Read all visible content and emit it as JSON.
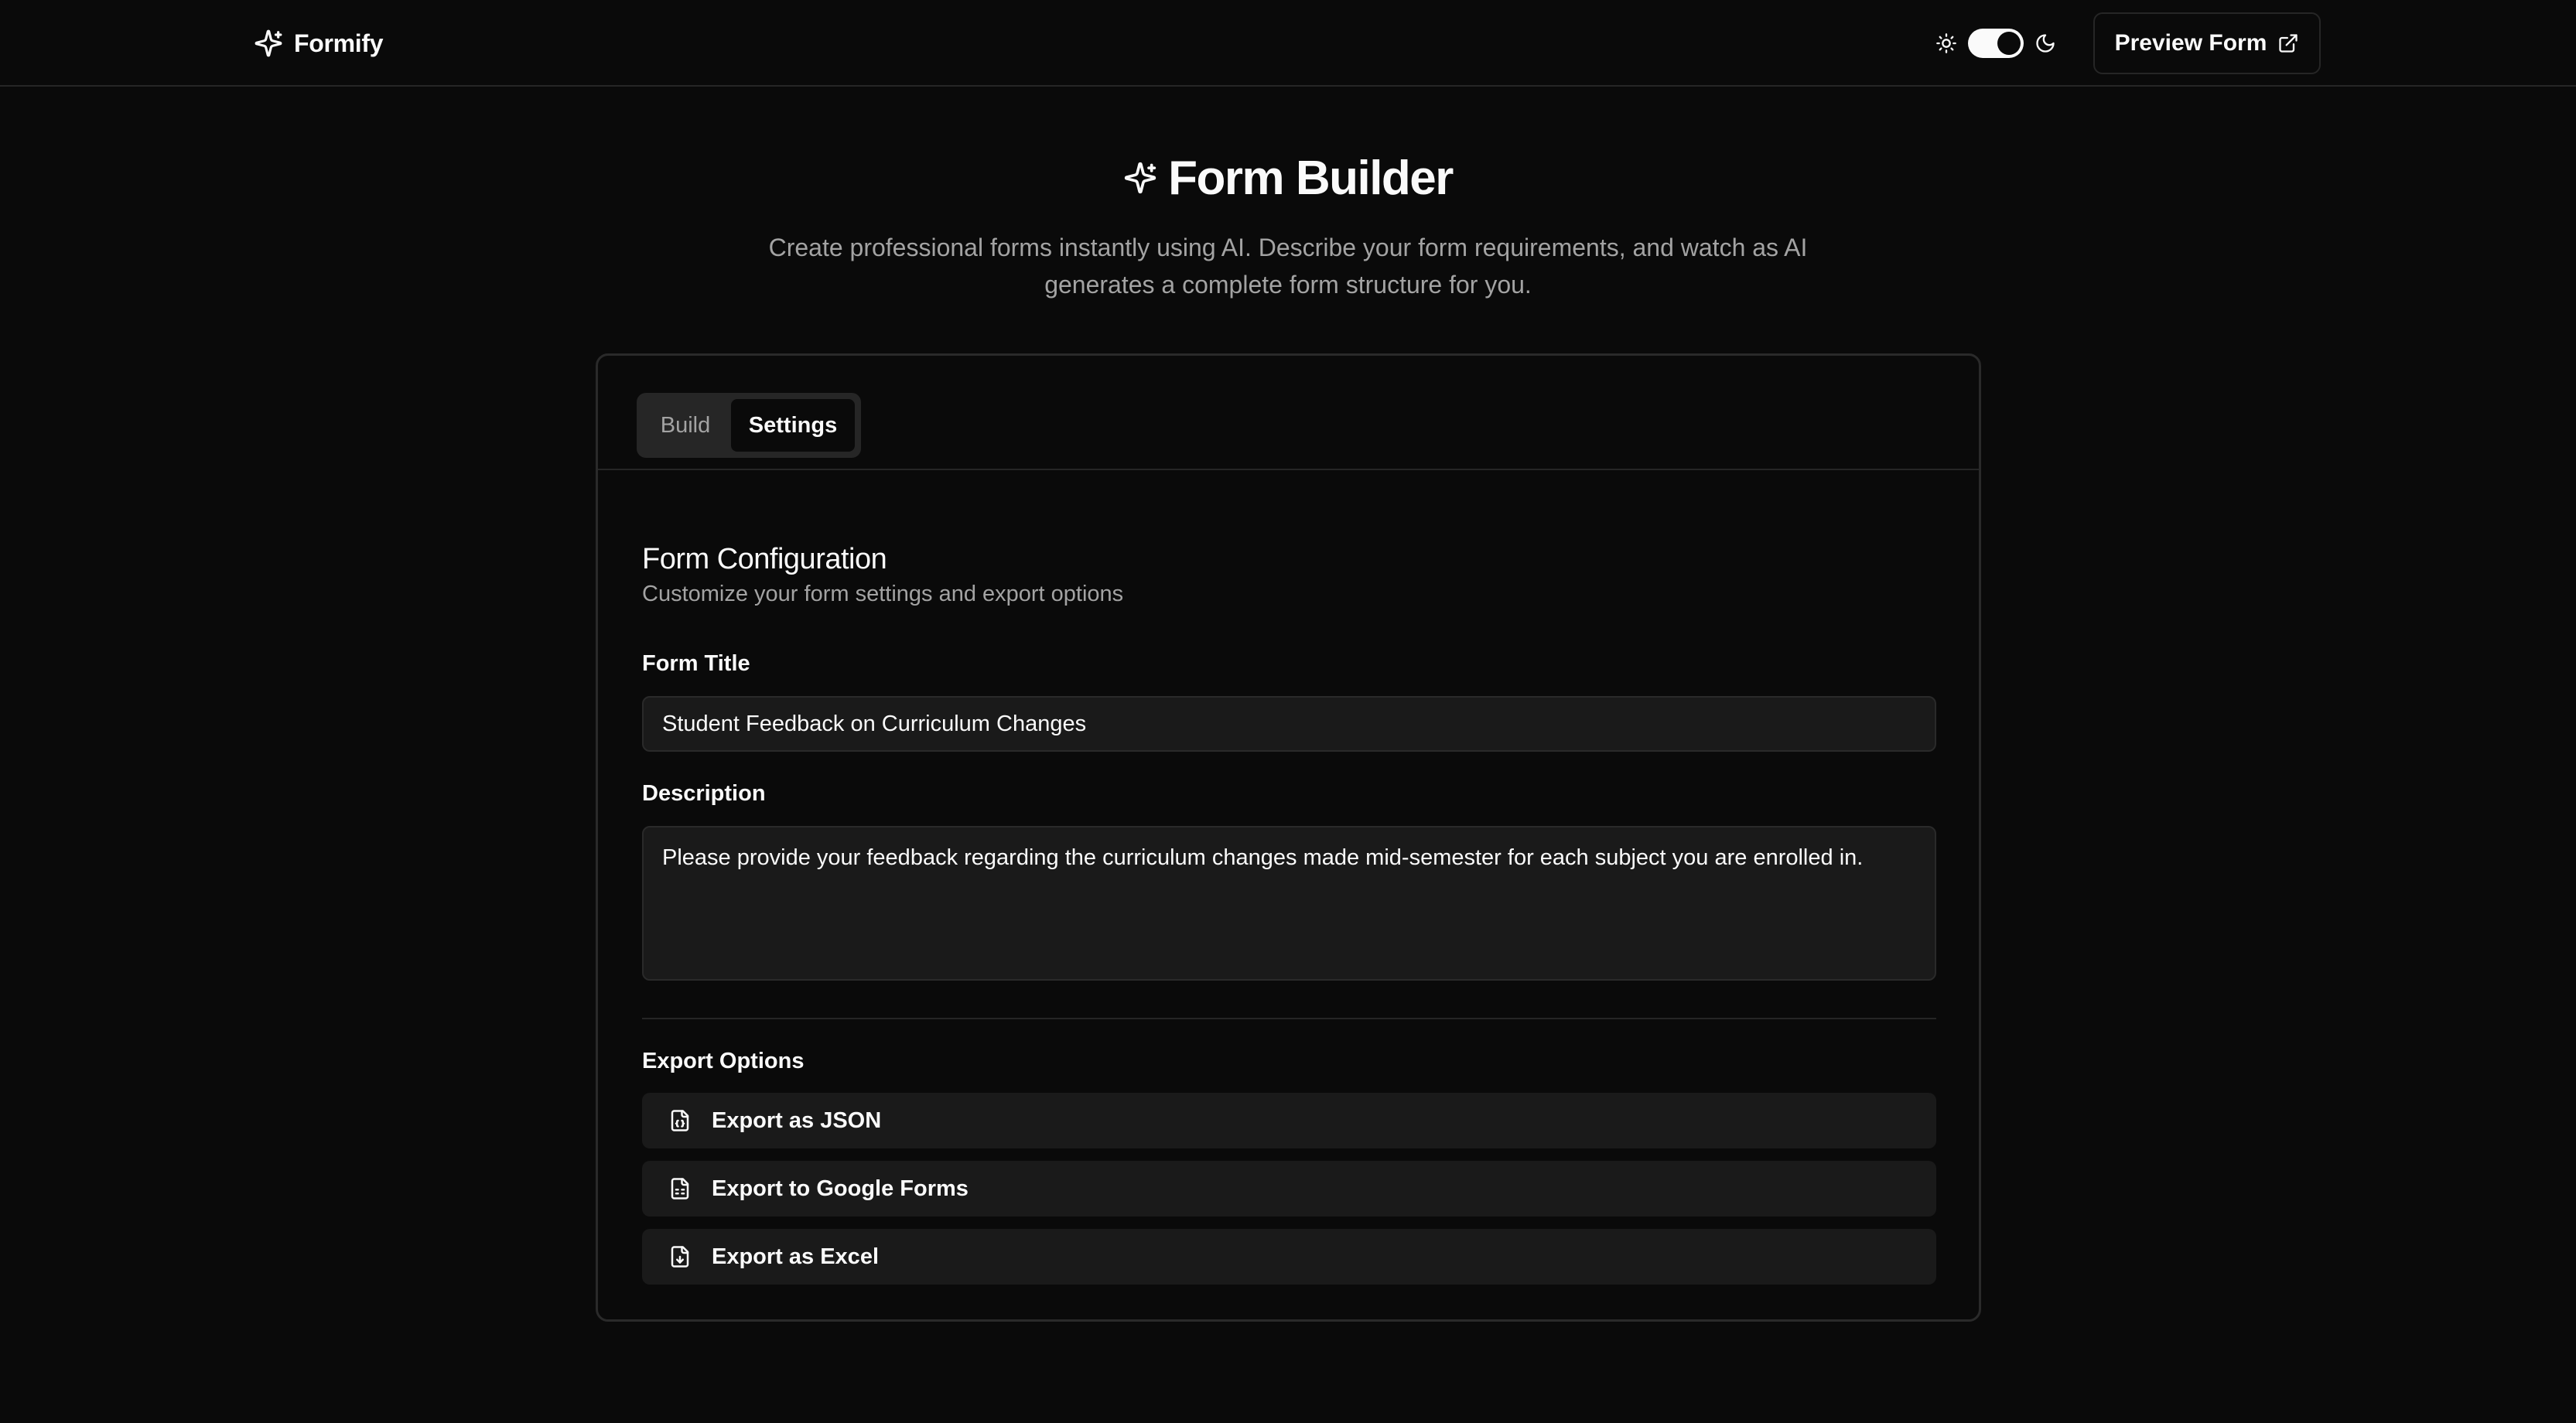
{
  "header": {
    "brand_name": "Formify",
    "preview_button_label": "Preview Form",
    "theme_dark_enabled": true
  },
  "hero": {
    "title": "Form Builder",
    "description": "Create professional forms instantly using AI. Describe your form requirements, and watch as AI generates a complete form structure for you."
  },
  "tabs": [
    {
      "label": "Build",
      "active": false
    },
    {
      "label": "Settings",
      "active": true
    }
  ],
  "settings": {
    "section_title": "Form Configuration",
    "section_subtitle": "Customize your form settings and export options",
    "form_title_label": "Form Title",
    "form_title_value": "Student Feedback on Curriculum Changes",
    "description_label": "Description",
    "description_value": "Please provide your feedback regarding the curriculum changes made mid-semester for each subject you are enrolled in.",
    "export_label": "Export Options",
    "export_options": [
      {
        "label": "Export as JSON",
        "icon": "file-json-icon"
      },
      {
        "label": "Export to Google Forms",
        "icon": "file-text-icon"
      },
      {
        "label": "Export as Excel",
        "icon": "file-download-icon"
      }
    ]
  },
  "colors": {
    "background": "#0a0a0a",
    "surface": "#1a1a1a",
    "border": "#262626",
    "text_primary": "#fafafa",
    "text_muted": "#a3a3a3"
  }
}
